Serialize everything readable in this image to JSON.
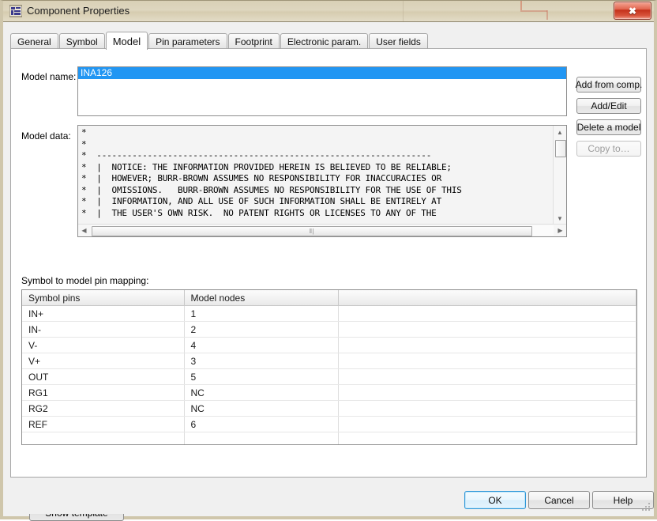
{
  "window": {
    "title": "Component Properties",
    "app_icon": "component-properties-icon",
    "close_label": "✖",
    "close_icon": "close-icon"
  },
  "tabs": [
    {
      "label": "General",
      "active": false
    },
    {
      "label": "Symbol",
      "active": false
    },
    {
      "label": "Model",
      "active": true
    },
    {
      "label": "Pin parameters",
      "active": false
    },
    {
      "label": "Footprint",
      "active": false
    },
    {
      "label": "Electronic param.",
      "active": false
    },
    {
      "label": "User fields",
      "active": false
    }
  ],
  "model": {
    "name_label": "Model name:",
    "name_options": [
      "INA126"
    ],
    "name_selected": "INA126",
    "data_label": "Model data:",
    "data_text": "*\n*\n*  ------------------------------------------------------------------\n*  |  NOTICE: THE INFORMATION PROVIDED HEREIN IS BELIEVED TO BE RELIABLE;\n*  |  HOWEVER; BURR-BROWN ASSUMES NO RESPONSIBILITY FOR INACCURACIES OR\n*  |  OMISSIONS.   BURR-BROWN ASSUMES NO RESPONSIBILITY FOR THE USE OF THIS\n*  |  INFORMATION, AND ALL USE OF SUCH INFORMATION SHALL BE ENTIRELY AT\n*  |  THE USER'S OWN RISK.  NO PATENT RIGHTS OR LICENSES TO ANY OF THE",
    "hscroll_grip": "‖|"
  },
  "side_buttons": [
    {
      "label": "Add from comp.",
      "disabled": false
    },
    {
      "label": "Add/Edit",
      "disabled": false
    },
    {
      "label": "Delete a model",
      "disabled": false
    },
    {
      "label": "Copy to…",
      "disabled": true
    }
  ],
  "mapping": {
    "label": "Symbol to model pin mapping:",
    "columns": [
      "Symbol pins",
      "Model nodes",
      ""
    ],
    "rows": [
      [
        "IN+",
        "1",
        ""
      ],
      [
        "IN-",
        "2",
        ""
      ],
      [
        "V-",
        "4",
        ""
      ],
      [
        "V+",
        "3",
        ""
      ],
      [
        "OUT",
        "5",
        ""
      ],
      [
        "RG1",
        "NC",
        ""
      ],
      [
        "RG2",
        "NC",
        ""
      ],
      [
        "REF",
        "6",
        ""
      ],
      [
        "",
        "",
        ""
      ],
      [
        "",
        "",
        ""
      ]
    ]
  },
  "show_template_label": "Show template",
  "dialog_buttons": {
    "ok": "OK",
    "cancel": "Cancel",
    "help": "Help"
  },
  "scroll_icons": {
    "up": "▲",
    "down": "▼",
    "left": "◀",
    "right": "▶"
  },
  "colors": {
    "titlebar": "#ded6bf",
    "selection": "#2196f3",
    "close_red": "#c4301a",
    "focus_blue": "#2e97d8"
  }
}
